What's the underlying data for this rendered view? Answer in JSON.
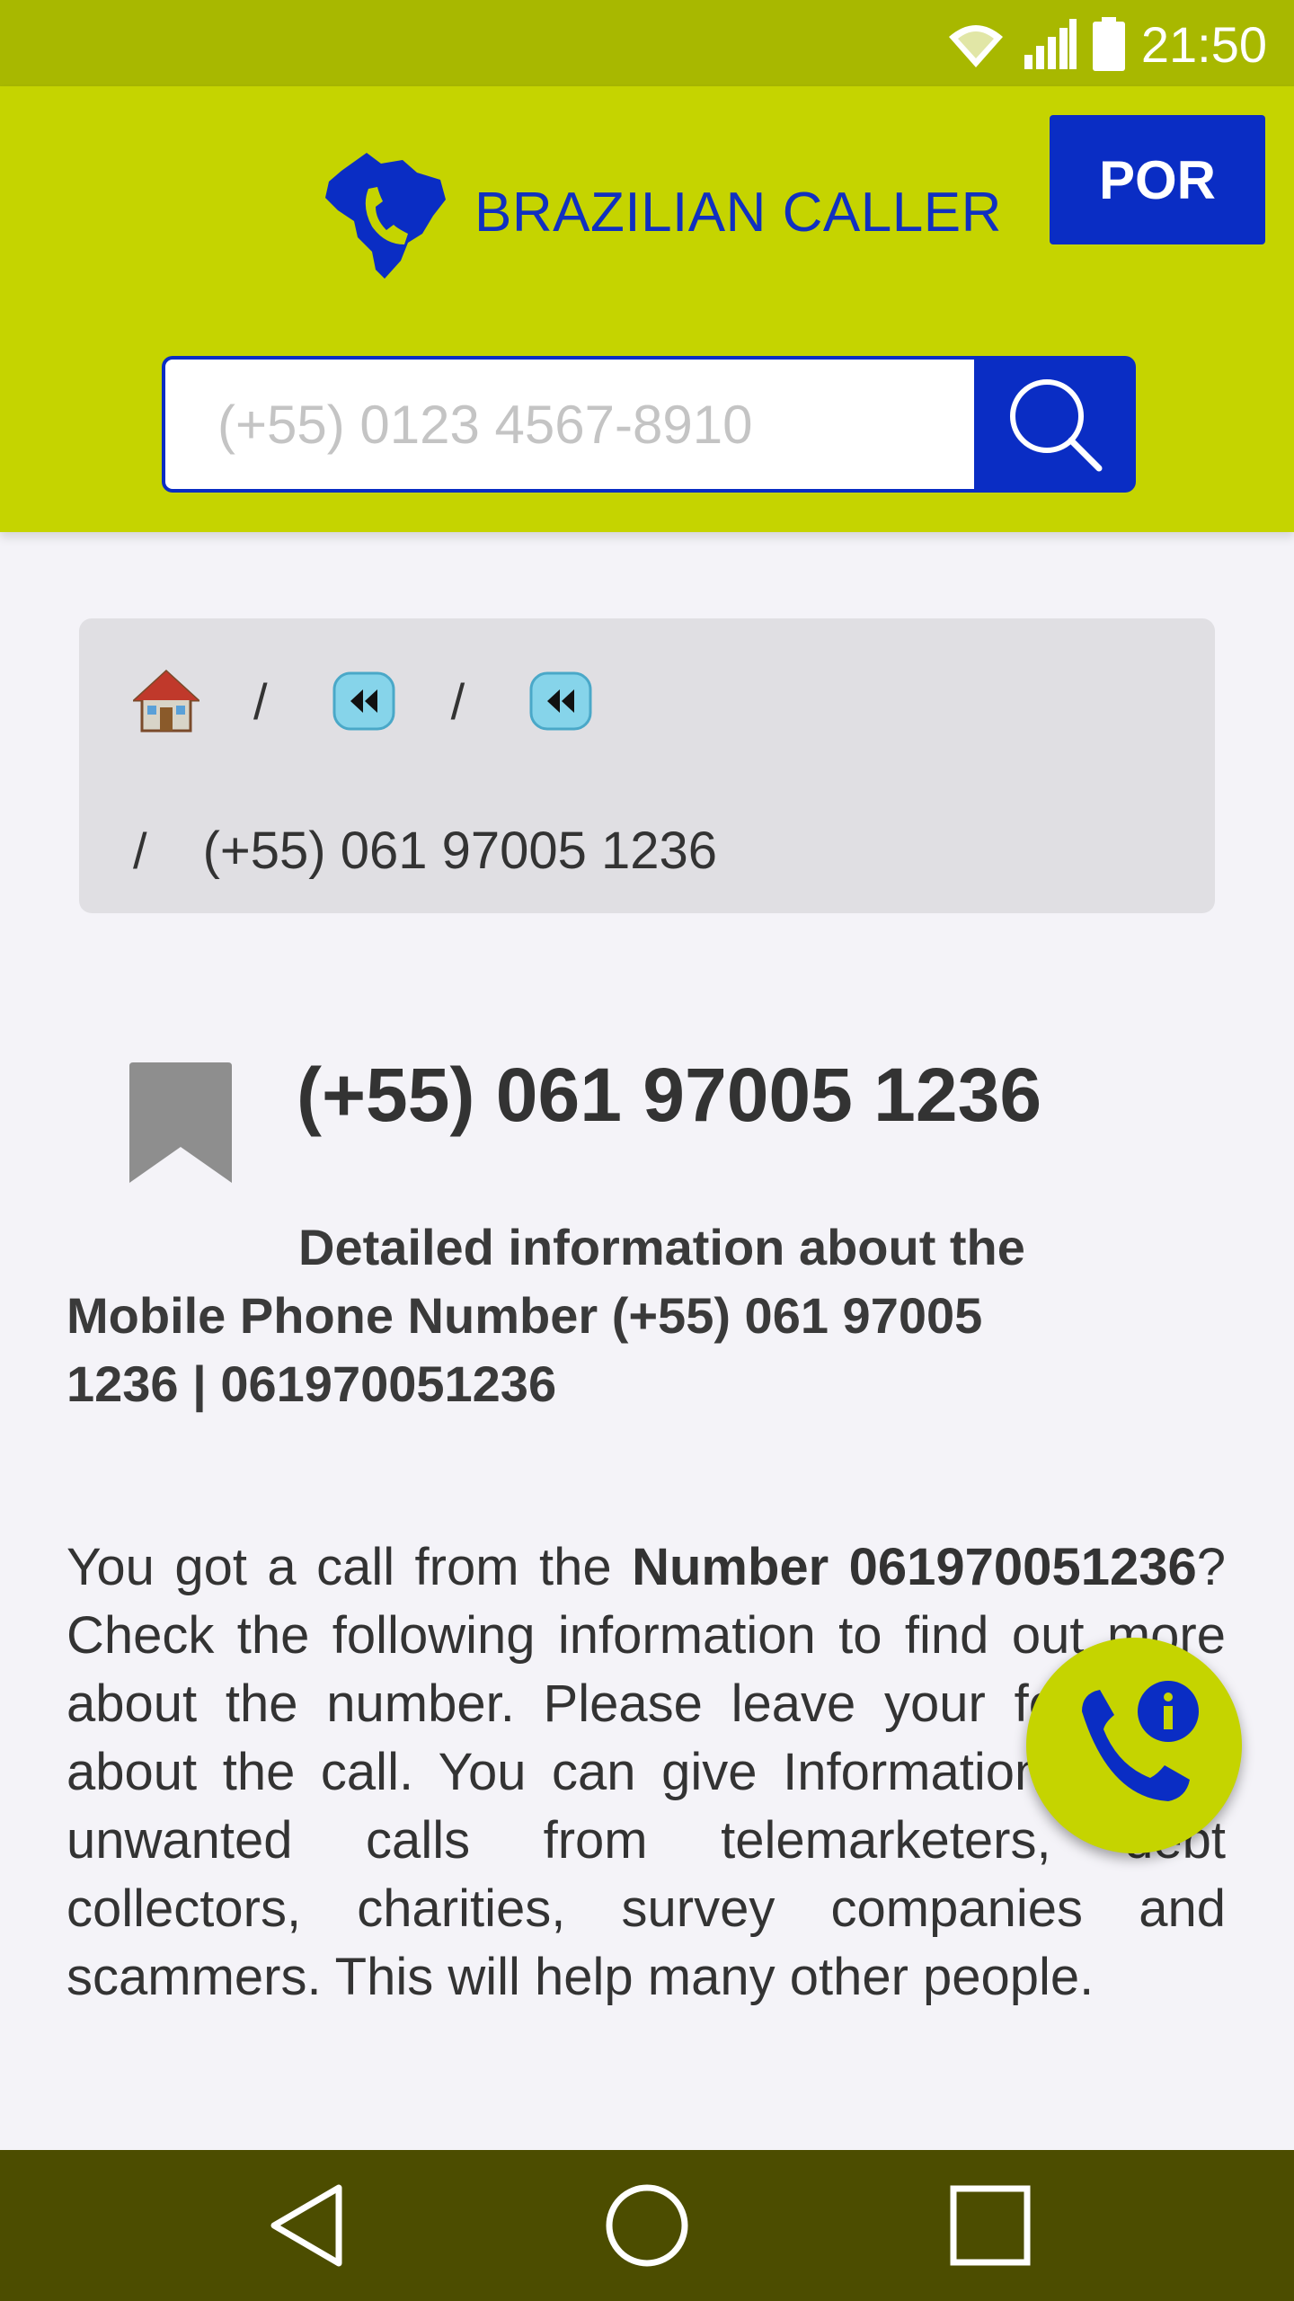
{
  "status_bar": {
    "time": "21:50",
    "icons": [
      "wifi-icon",
      "signal-icon",
      "battery-icon"
    ]
  },
  "header": {
    "brand_title": "BRAZILIAN CALLER",
    "logo_icon": "brazil-phone-logo-icon",
    "language_button": "POR",
    "search": {
      "placeholder": "(+55) 0123 4567-8910",
      "button_icon": "search-icon"
    }
  },
  "breadcrumb": {
    "separator": "/",
    "items": [
      "home-icon",
      "rewind-icon",
      "rewind-icon"
    ],
    "current": "(+55) 061 97005 1236"
  },
  "main": {
    "number_title": "(+55) 061 97005 1236",
    "detail_heading": "Detailed information about the Mobile Phone Number (+55) 061 97005 1236 | 061970051236",
    "intro": {
      "p1": "You got a call from the ",
      "number_bold": "Number 061970051236",
      "p2": "? Check the following information to find out more about the number. Please leave your feedback about the call. You can give Informations about unwanted calls from telemarketers, debt collectors, charities, survey companies and scammers. This will help many other people."
    }
  },
  "fab": {
    "icon": "phone-info-icon"
  },
  "nav_bar": {
    "buttons": [
      "back-icon",
      "home-circle-icon",
      "recents-square-icon"
    ]
  },
  "colors": {
    "status_bar": "#a8b800",
    "header": "#c5d400",
    "brand_blue": "#0a2dc4",
    "nav_bar": "#4c4d00"
  }
}
